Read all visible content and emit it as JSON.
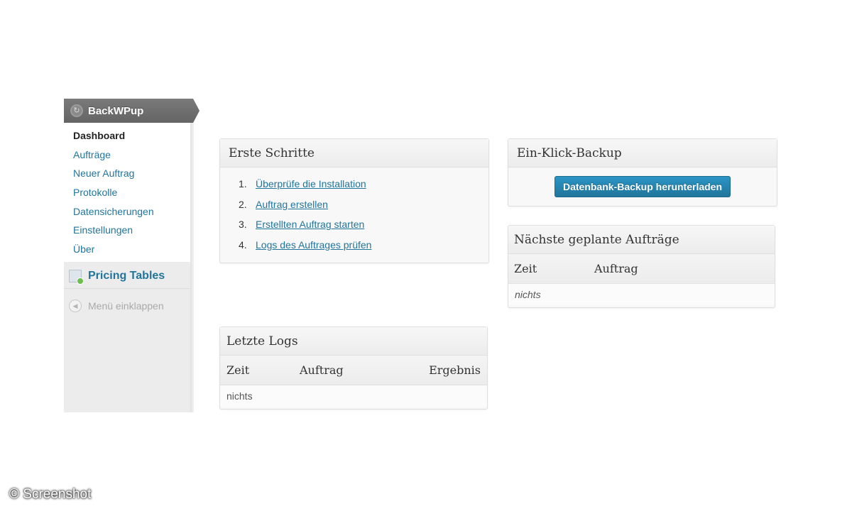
{
  "sidebar": {
    "plugin_title": "BackWPup",
    "plugin_icon": "backwpup-logo-icon",
    "items": [
      {
        "label": "Dashboard",
        "current": true
      },
      {
        "label": "Aufträge"
      },
      {
        "label": "Neuer Auftrag"
      },
      {
        "label": "Protokolle"
      },
      {
        "label": "Datensicherungen"
      },
      {
        "label": "Einstellungen"
      },
      {
        "label": "Über"
      }
    ],
    "pricing_tables": "Pricing Tables",
    "collapse_menu": "Menü einklappen"
  },
  "first_steps": {
    "title": "Erste Schritte",
    "steps": [
      {
        "num": "1.",
        "label": "Überprüfe die Installation"
      },
      {
        "num": "2.",
        "label": "Auftrag erstellen"
      },
      {
        "num": "3.",
        "label": "Erstellten Auftrag starten"
      },
      {
        "num": "4.",
        "label": "Logs des Auftrages prüfen"
      }
    ]
  },
  "one_click": {
    "title": "Ein-Klick-Backup",
    "button": "Datenbank-Backup herunterladen"
  },
  "next_jobs": {
    "title": "Nächste geplante Aufträge",
    "columns": [
      "Zeit",
      "Auftrag"
    ],
    "empty": "nichts"
  },
  "last_logs": {
    "title": "Letzte Logs",
    "columns": [
      "Zeit",
      "Auftrag",
      "Ergebnis"
    ],
    "empty": "nichts"
  },
  "watermark": "© Screenshot",
  "colors": {
    "link": "#21759b",
    "button": "#21759b",
    "menu_head": "#6d6d6d"
  }
}
